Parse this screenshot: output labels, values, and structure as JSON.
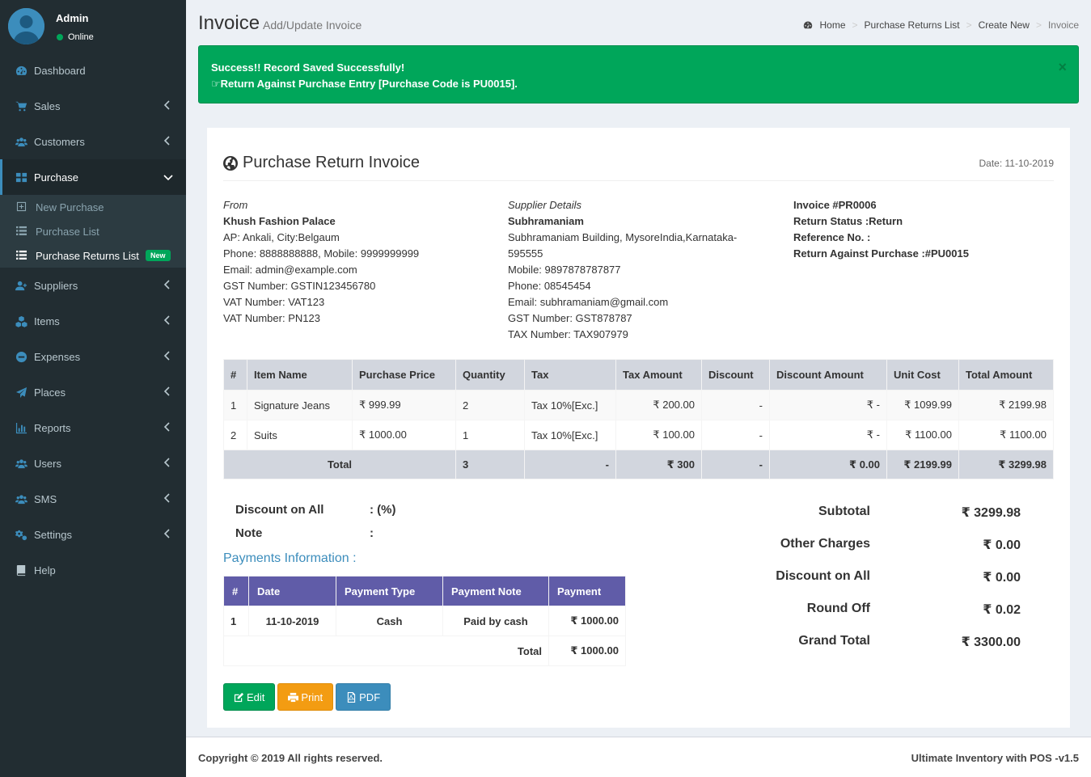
{
  "user": {
    "name": "Admin",
    "status": "Online"
  },
  "sidebar": {
    "items": [
      {
        "label": "Dashboard",
        "icon": "dashboard-icon"
      },
      {
        "label": "Sales",
        "icon": "cart-icon"
      },
      {
        "label": "Customers",
        "icon": "users-icon"
      },
      {
        "label": "Purchase",
        "icon": "grid-icon"
      },
      {
        "label": "Suppliers",
        "icon": "user-plus-icon"
      },
      {
        "label": "Items",
        "icon": "cubes-icon"
      },
      {
        "label": "Expenses",
        "icon": "minus-circle-icon"
      },
      {
        "label": "Places",
        "icon": "paper-plane-icon"
      },
      {
        "label": "Reports",
        "icon": "bar-chart-icon"
      },
      {
        "label": "Users",
        "icon": "users-icon"
      },
      {
        "label": "SMS",
        "icon": "users-icon"
      },
      {
        "label": "Settings",
        "icon": "cogs-icon"
      },
      {
        "label": "Help",
        "icon": "book-icon"
      }
    ],
    "submenu": [
      {
        "label": "New Purchase"
      },
      {
        "label": "Purchase List"
      },
      {
        "label": "Purchase Returns List",
        "badge": "New"
      }
    ]
  },
  "header": {
    "title": "Invoice",
    "subtitle": "Add/Update Invoice"
  },
  "breadcrumb": [
    "Home",
    "Purchase Returns List",
    "Create New",
    "Invoice"
  ],
  "alert": {
    "line1": "Success!! Record Saved Successfully!",
    "line2": "Return Against Purchase Entry [Purchase Code is PU0015].",
    "close": "×"
  },
  "invoice": {
    "title": "Purchase Return Invoice",
    "date": "Date: 11-10-2019",
    "from": {
      "heading": "From",
      "name": "Khush Fashion Palace",
      "lines": [
        "AP: Ankali, City:Belgaum",
        "Phone: 8888888888, Mobile: 9999999999",
        "Email: admin@example.com",
        "GST Number: GSTIN123456780",
        "VAT Number: VAT123",
        "VAT Number: PN123"
      ]
    },
    "supplier": {
      "heading": "Supplier Details",
      "name": "Subhramaniam",
      "lines": [
        "Subhramaniam Building, MysoreIndia,Karnataka-",
        "595555",
        "Mobile: 9897878787877",
        "Phone: 08545454",
        "Email: subhramaniam@gmail.com",
        "GST Number: GST878787",
        "TAX Number: TAX907979"
      ]
    },
    "meta": [
      "Invoice #PR0006",
      "Return Status :Return",
      "Reference No. :",
      "Return Against Purchase :#PU0015"
    ],
    "columns": [
      "#",
      "Item Name",
      "Purchase Price",
      "Quantity",
      "Tax",
      "Tax Amount",
      "Discount",
      "Discount Amount",
      "Unit Cost",
      "Total Amount"
    ],
    "rows": [
      [
        "1",
        "Signature Jeans",
        "₹ 999.99",
        "2",
        "Tax 10%[Exc.]",
        "₹ 200.00",
        "-",
        "₹ -",
        "₹ 1099.99",
        "₹ 2199.98"
      ],
      [
        "2",
        "Suits",
        "₹ 1000.00",
        "1",
        "Tax 10%[Exc.]",
        "₹ 100.00",
        "-",
        "₹ -",
        "₹ 1100.00",
        "₹ 1100.00"
      ]
    ],
    "total_row": [
      "Total",
      "3",
      "-",
      "₹ 300",
      "-",
      "₹ 0.00",
      "₹ 2199.99",
      "₹ 3299.98"
    ],
    "discount_label": "Discount on All",
    "discount_value": ": (%)",
    "note_label": "Note",
    "note_value": ":"
  },
  "payments": {
    "heading": "Payments Information :",
    "columns": [
      "#",
      "Date",
      "Payment Type",
      "Payment Note",
      "Payment"
    ],
    "rows": [
      [
        "1",
        "11-10-2019",
        "Cash",
        "Paid by cash",
        "₹ 1000.00"
      ]
    ],
    "total_label": "Total",
    "total_value": "₹ 1000.00"
  },
  "summary": [
    {
      "label": "Subtotal",
      "value": "₹ 3299.98"
    },
    {
      "label": "Other Charges",
      "value": "₹ 0.00"
    },
    {
      "label": "Discount on All",
      "value": "₹ 0.00"
    },
    {
      "label": "Round Off",
      "value": "₹ 0.02"
    },
    {
      "label": "Grand Total",
      "value": "₹ 3300.00"
    }
  ],
  "buttons": {
    "edit": "Edit",
    "print": "Print",
    "pdf": "PDF"
  },
  "footer": {
    "copyright": "Copyright © 2019 All rights reserved.",
    "version": "Ultimate Inventory with POS -v1.5"
  },
  "colors": {
    "sidebar": "#222d32",
    "accent": "#3c8dbc",
    "success": "#00a65a",
    "warning": "#f39c12",
    "purple": "#605ca8"
  }
}
